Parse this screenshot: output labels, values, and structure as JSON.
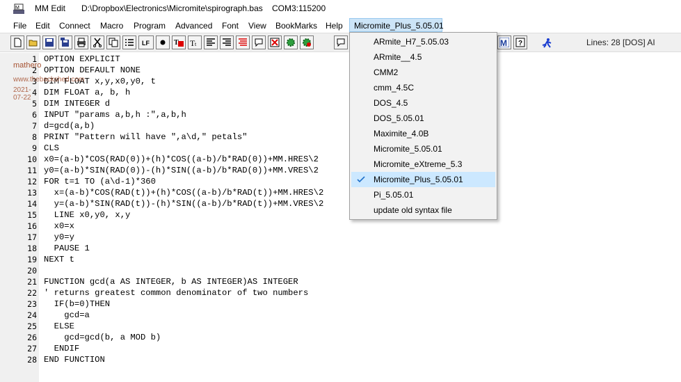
{
  "titlebar": {
    "app_name": "MM Edit",
    "file_path": "D:\\Dropbox\\Electronics\\Micromite\\spirograph.bas",
    "com_port": "COM3:115200"
  },
  "menubar": {
    "items": [
      "File",
      "Edit",
      "Connect",
      "Macro",
      "Program",
      "Advanced",
      "Font",
      "View",
      "BookMarks",
      "Help"
    ],
    "open_menu": "Micromite_Plus_5.05.01"
  },
  "toolbar": {
    "buttons": [
      "new-file-icon",
      "open-folder-icon",
      "save-icon",
      "save-as-icon",
      "print-icon",
      "cut-icon",
      "copy-icon",
      "list-icon",
      "lf-icon",
      "bullet-icon",
      "text-color-icon",
      "text-size-icon",
      "align-left-icon",
      "align-right-icon",
      "align-red-icon",
      "speech-bubble-icon",
      "delete-icon",
      "gear-green-icon",
      "gear-red-icon",
      "comment-icon",
      "macro-m-icon",
      "help-icon",
      "run-icon"
    ],
    "lf_label": "LF",
    "status": "Lines: 28  [DOS]  AI"
  },
  "watermark": {
    "name": "mathero",
    "site": "www.thebackshed.com",
    "date": "2021-07-22"
  },
  "code": {
    "lines": [
      "OPTION EXPLICIT",
      "OPTION DEFAULT NONE",
      "DIM FLOAT x,y,x0,y0, t",
      "DIM FLOAT a, b, h",
      "DIM INTEGER d",
      "INPUT \"params a,b,h :\",a,b,h",
      "d=gcd(a,b)",
      "PRINT \"Pattern will have \",a\\d,\" petals\"",
      "CLS",
      "x0=(a-b)*COS(RAD(0))+(h)*COS((a-b)/b*RAD(0))+MM.HRES\\2",
      "y0=(a-b)*SIN(RAD(0))-(h)*SIN((a-b)/b*RAD(0))+MM.VRES\\2",
      "FOR t=1 TO (a\\d-1)*360",
      "  x=(a-b)*COS(RAD(t))+(h)*COS((a-b)/b*RAD(t))+MM.HRES\\2",
      "  y=(a-b)*SIN(RAD(t))-(h)*SIN((a-b)/b*RAD(t))+MM.VRES\\2",
      "  LINE x0,y0, x,y",
      "  x0=x",
      "  y0=y",
      "  PAUSE 1",
      "NEXT t",
      "",
      "FUNCTION gcd(a AS INTEGER, b AS INTEGER)AS INTEGER",
      "' returns greatest common denominator of two numbers",
      "  IF(b=0)THEN",
      "    gcd=a",
      "  ELSE",
      "    gcd=gcd(b, a MOD b)",
      "  ENDIF",
      "END FUNCTION"
    ]
  },
  "dropdown": {
    "items": [
      "ARmite_H7_5.05.03",
      "ARmite__4.5",
      "CMM2",
      "cmm_4.5C",
      "DOS_4.5",
      "DOS_5.05.01",
      "Maximite_4.0B",
      "Micromite_5.05.01",
      "Micromite_eXtreme_5.3",
      "Micromite_Plus_5.05.01",
      "Pi_5.05.01",
      "update old syntax file"
    ],
    "checked": "Micromite_Plus_5.05.01"
  },
  "colors": {
    "menu_highlight": "#cce4f7",
    "checked_item_bg": "#cce8ff",
    "check_mark": "#1e6fc9",
    "watermark": "#a5502f",
    "gutter": "#f0f0f0"
  }
}
